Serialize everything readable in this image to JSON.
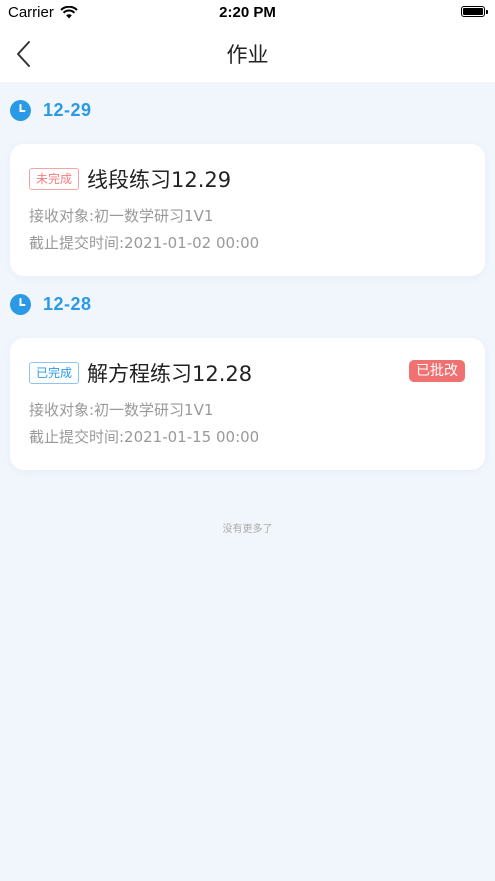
{
  "status_bar": {
    "carrier": "Carrier",
    "time": "2:20 PM"
  },
  "nav": {
    "title": "作业"
  },
  "groups": [
    {
      "date": "12-29",
      "item": {
        "status": "未完成",
        "title": "线段练习12.29",
        "receiver": "接收对象:初一数学研习1V1",
        "deadline": "截止提交时间:2021-01-02 00:00"
      }
    },
    {
      "date": "12-28",
      "item": {
        "status": "已完成",
        "title": "解方程练习12.28",
        "grade_badge": "已批改",
        "receiver": "接收对象:初一数学研习1V1",
        "deadline": "截止提交时间:2021-01-15 00:00"
      }
    }
  ],
  "footer": {
    "no_more": "没有更多了"
  },
  "colors": {
    "accent": "#2b9ae6",
    "todo": "#f27d7d",
    "graded": "#f07171"
  }
}
